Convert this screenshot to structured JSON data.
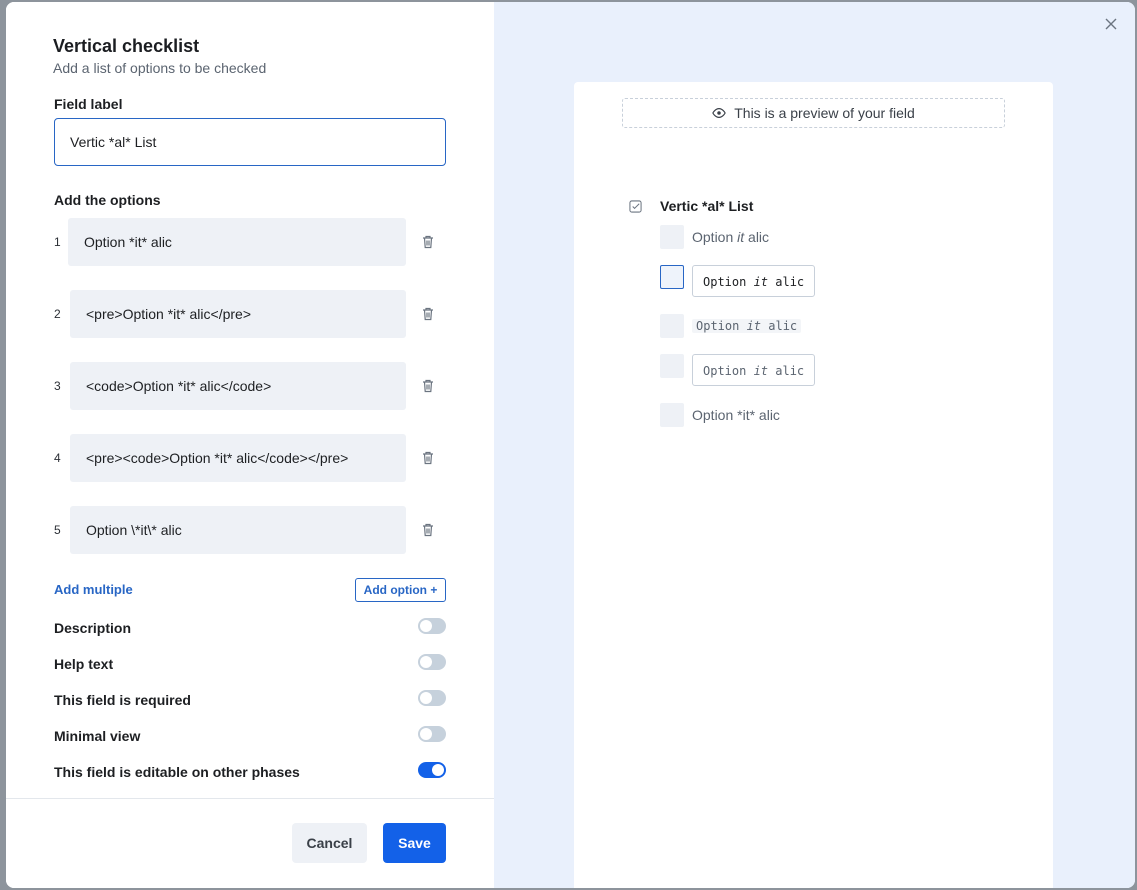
{
  "modal": {
    "title": "Vertical checklist",
    "subtitle": "Add a list of options to be checked",
    "field_label_caption": "Field label",
    "field_label_value": "Vertic *al* List",
    "options_caption": "Add the options",
    "options": [
      {
        "number": "1",
        "value": "Option *it* alic"
      },
      {
        "number": "2",
        "value": "<pre>Option *it* alic</pre>"
      },
      {
        "number": "3",
        "value": "<code>Option *it* alic</code>"
      },
      {
        "number": "4",
        "value": "<pre><code>Option *it* alic</code></pre>"
      },
      {
        "number": "5",
        "value": "Option \\*it\\* alic"
      }
    ],
    "add_multiple_label": "Add multiple",
    "add_option_label": "Add option +",
    "toggles": [
      {
        "label": "Description",
        "on": false
      },
      {
        "label": "Help text",
        "on": false
      },
      {
        "label": "This field is required",
        "on": false
      },
      {
        "label": "Minimal view",
        "on": false
      },
      {
        "label": "This field is editable on other phases",
        "on": true
      }
    ],
    "cancel_label": "Cancel",
    "save_label": "Save"
  },
  "preview": {
    "banner": "This is a preview of your field",
    "field_label": "Vertic *al* List",
    "items": [
      {
        "before": "Option ",
        "italic": "it",
        "after": " alic"
      },
      {
        "before": "Option ",
        "italic": "it",
        "after": " alic"
      },
      {
        "before": "Option ",
        "italic": "it",
        "after": " alic"
      },
      {
        "before": "Option ",
        "italic": "it",
        "after": " alic"
      },
      {
        "text": "Option *it* alic"
      }
    ]
  },
  "colors": {
    "accent": "#1361e8",
    "link": "#2866c5",
    "preview_bg": "#e9f0fc"
  }
}
